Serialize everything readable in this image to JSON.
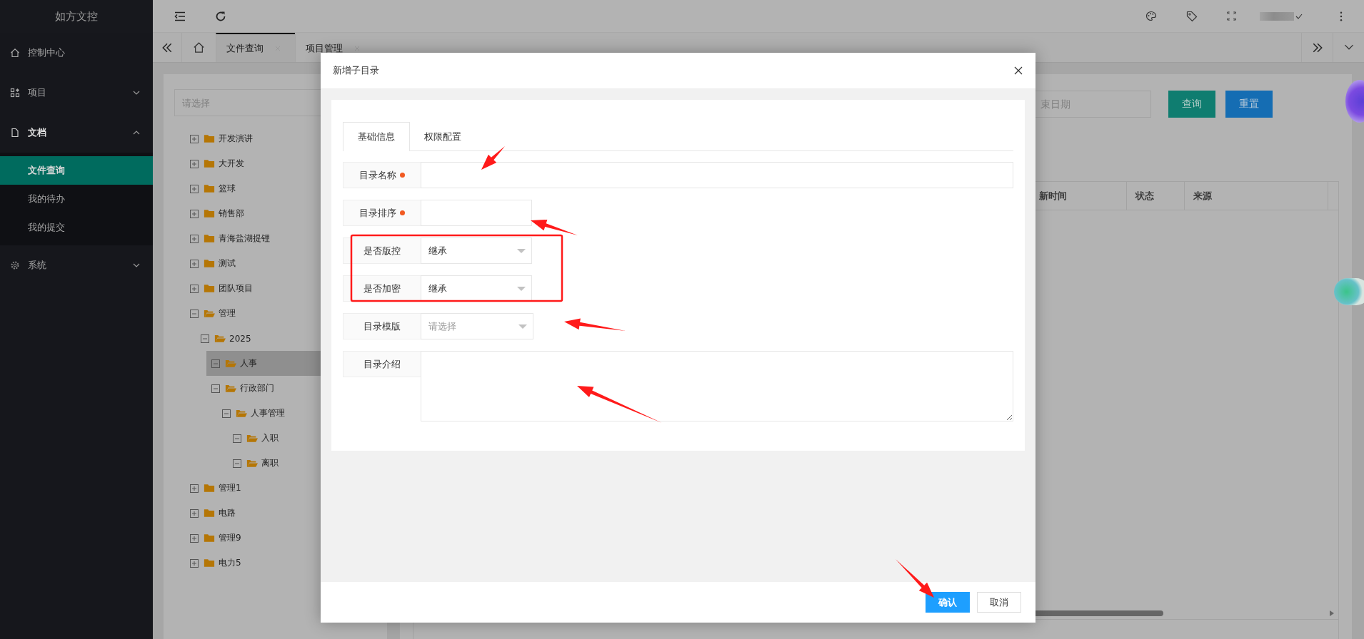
{
  "app": {
    "title": "如方文控"
  },
  "sidebar": {
    "items": [
      {
        "label": "控制中心"
      },
      {
        "label": "项目",
        "expanded": false
      },
      {
        "label": "文档",
        "expanded": true,
        "children": [
          {
            "label": "文件查询",
            "selected": true
          },
          {
            "label": "我的待办",
            "selected": false
          },
          {
            "label": "我的提交",
            "selected": false
          }
        ]
      },
      {
        "label": "系统",
        "expanded": false
      }
    ]
  },
  "page_tabs": [
    {
      "label": "文件查询",
      "selected": true
    },
    {
      "label": "项目管理",
      "selected": false
    }
  ],
  "tree": {
    "search": {
      "placeholder": "请选择"
    },
    "items": [
      {
        "label": "开发演讲",
        "expanded": false,
        "selected": false
      },
      {
        "label": "大开发",
        "expanded": false,
        "selected": false
      },
      {
        "label": "篮球",
        "expanded": false,
        "selected": false
      },
      {
        "label": "销售部",
        "expanded": false,
        "selected": false
      },
      {
        "label": "青海盐湖提锂",
        "expanded": false,
        "selected": false
      },
      {
        "label": "测试",
        "expanded": false,
        "selected": false
      },
      {
        "label": "团队项目",
        "expanded": false,
        "selected": false
      },
      {
        "label": "管理",
        "expanded": true,
        "selected": false,
        "children": [
          {
            "label": "2025",
            "expanded": true,
            "selected": false,
            "children": [
              {
                "label": "人事",
                "expanded": true,
                "selected": true
              },
              {
                "label": "行政部门",
                "expanded": true,
                "selected": false,
                "children": [
                  {
                    "label": "人事管理",
                    "expanded": true,
                    "selected": false,
                    "children": [
                      {
                        "label": "入职",
                        "expanded": true,
                        "selected": false
                      },
                      {
                        "label": "离职",
                        "expanded": true,
                        "selected": false
                      }
                    ]
                  }
                ]
              }
            ]
          }
        ]
      },
      {
        "label": "管理1",
        "expanded": false,
        "selected": false
      },
      {
        "label": "电路",
        "expanded": false,
        "selected": false
      },
      {
        "label": "管理9",
        "expanded": false,
        "selected": false
      },
      {
        "label": "电力5",
        "expanded": false,
        "selected": false
      }
    ]
  },
  "query": {
    "date_field": {
      "placeholder": "束日期"
    },
    "buttons": [
      {
        "label": "查询",
        "kind": "search"
      },
      {
        "label": "重置",
        "kind": "reset"
      }
    ]
  },
  "table": {
    "columns": [
      "新时间",
      "状态",
      "来源"
    ]
  },
  "dialog": {
    "title": "新增子目录",
    "tabs": [
      {
        "label": "基础信息",
        "selected": true
      },
      {
        "label": "权限配置",
        "selected": false
      }
    ],
    "fields": [
      {
        "kind": "text",
        "label": "目录名称",
        "required": true
      },
      {
        "kind": "number",
        "label": "目录排序",
        "required": true
      },
      {
        "kind": "select",
        "label": "是否版控",
        "required": false,
        "value": "继承"
      },
      {
        "kind": "select",
        "label": "是否加密",
        "required": false,
        "value": "继承"
      },
      {
        "kind": "select",
        "label": "目录模版",
        "required": false,
        "placeholder": "请选择"
      },
      {
        "kind": "textarea",
        "label": "目录介绍",
        "required": false
      }
    ],
    "buttons": [
      {
        "label": "确认",
        "kind": "primary"
      },
      {
        "label": "取消",
        "kind": "default"
      }
    ]
  }
}
